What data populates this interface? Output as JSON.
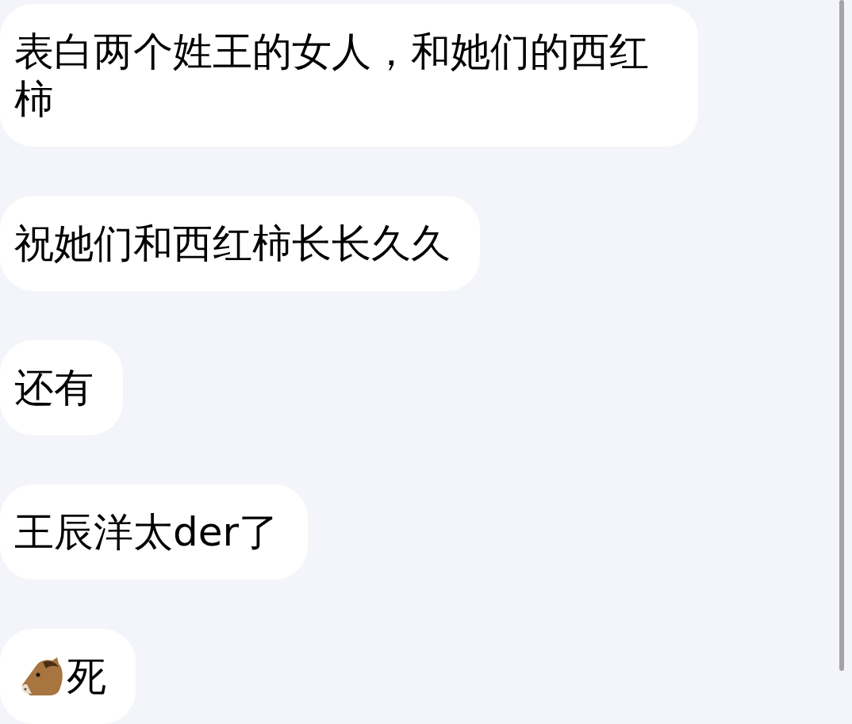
{
  "messages": [
    {
      "kind": "text",
      "text": "表白两个姓王的女人，和她们的西红柿"
    },
    {
      "kind": "text",
      "text": "祝她们和西红柿长长久久"
    },
    {
      "kind": "text",
      "text": "还有"
    },
    {
      "kind": "text",
      "text": "王辰洋太der了"
    },
    {
      "kind": "icon_text",
      "text": "死"
    }
  ]
}
